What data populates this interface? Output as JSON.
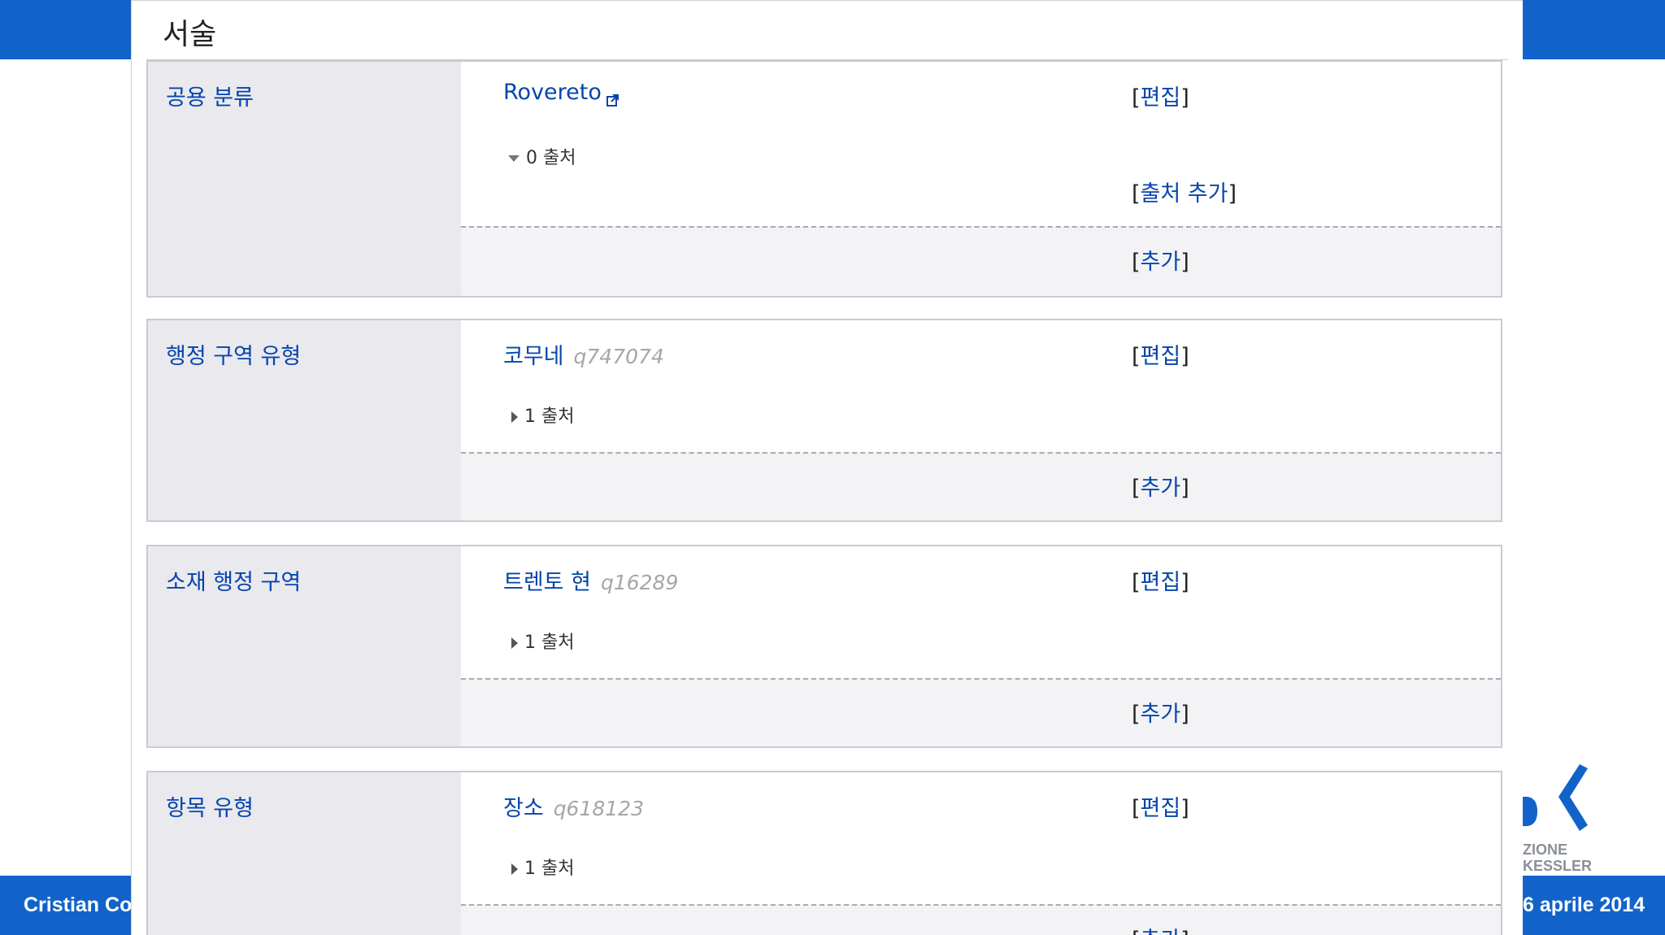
{
  "slide": {
    "footer_left": "Cristian Co",
    "footer_right": "6 aprile 2014",
    "logo_text_1": "ZIONE",
    "logo_text_2": "KESSLER",
    "colors": {
      "accent": "#1263c9",
      "link": "#0645ad",
      "label_bg": "#e9e9ee"
    }
  },
  "section": {
    "heading": "서술"
  },
  "statements": [
    {
      "property": "공용 분류",
      "value": "Rovereto",
      "qid": "",
      "external_link": true,
      "references": "0 출처",
      "references_expanded": true,
      "edit": "편집",
      "add_reference": "출처 추가",
      "add": "추가"
    },
    {
      "property": "행정 구역 유형",
      "value": "코무네",
      "qid": "q747074",
      "external_link": false,
      "references": "1 출처",
      "references_expanded": false,
      "edit": "편집",
      "add": "추가"
    },
    {
      "property": "소재 행정 구역",
      "value": "트렌토 현",
      "qid": "q16289",
      "external_link": false,
      "references": "1 출처",
      "references_expanded": false,
      "edit": "편집",
      "add": "추가"
    },
    {
      "property": "항목 유형",
      "value": "장소",
      "qid": "q618123",
      "external_link": false,
      "references": "1 출처",
      "references_expanded": false,
      "edit": "편집",
      "add": "추가"
    }
  ]
}
